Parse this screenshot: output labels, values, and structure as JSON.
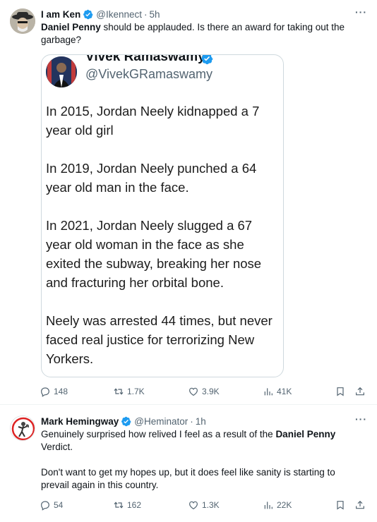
{
  "tweets": [
    {
      "name": "I am Ken",
      "handle": "@Ikennect",
      "dot": "·",
      "time": "5h",
      "more": "···",
      "text_bold": "Daniel Penny",
      "text_rest": " should be applauded. Is there an award for taking out the garbage?",
      "quote": {
        "name": "Vivek Ramaswamy",
        "handle": "@VivekGRamaswamy",
        "paragraphs": [
          "In 2015, Jordan Neely kidnapped a 7 year old girl",
          "In 2019, Jordan Neely punched a 64 year old man in the face.",
          "In 2021, Jordan Neely slugged a 67 year old woman in the face as she exited the subway, breaking her nose and fracturing her orbital bone.",
          "Neely was arrested 44 times, but never faced real justice for terrorizing New Yorkers."
        ]
      },
      "stats": {
        "replies": "148",
        "retweets": "1.7K",
        "likes": "3.9K",
        "views": "41K"
      }
    },
    {
      "name": "Mark Hemingway",
      "handle": "@Heminator",
      "dot": "·",
      "time": "1h",
      "more": "···",
      "text_line1_start": "Genuinely surprised how relived I feel as a result of the ",
      "text_line1_bold": "Daniel Penny",
      "text_line1_end": " Verdict.",
      "text_line2": "Don't want to get my hopes up, but it does feel like sanity is starting to prevail again in this country.",
      "stats": {
        "replies": "54",
        "retweets": "162",
        "likes": "1.3K",
        "views": "22K"
      }
    }
  ],
  "colors": {
    "verified": "#1d9bf0",
    "muted": "#536471",
    "text": "#0f1419",
    "border": "#cfd9de"
  },
  "icons": [
    "verified-badge-icon",
    "reply-icon",
    "retweet-icon",
    "like-icon",
    "views-icon",
    "bookmark-icon",
    "share-icon",
    "more-icon"
  ]
}
